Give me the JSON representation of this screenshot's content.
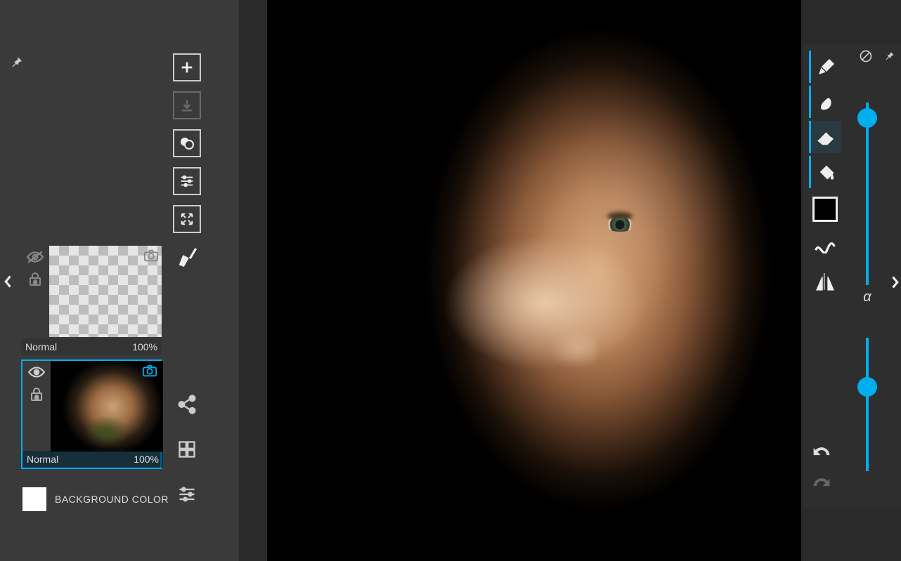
{
  "left_panel": {
    "pin": "pin-icon",
    "actions": [
      {
        "name": "add-layer-button",
        "icon": "plus-icon"
      },
      {
        "name": "merge-down-button",
        "icon": "arrow-down-box-icon",
        "disabled": true
      },
      {
        "name": "duplicate-layer-button",
        "icon": "overlap-circles-icon"
      },
      {
        "name": "layer-options-button",
        "icon": "sliders-icon"
      },
      {
        "name": "transform-layer-button",
        "icon": "expand-arrows-icon"
      },
      {
        "name": "clear-layer-button",
        "icon": "brush-sweep-icon",
        "noborder": true
      }
    ],
    "layers": [
      {
        "blend": "Normal",
        "opacity": "100%",
        "visible": false,
        "locked": true,
        "selected": false,
        "thumb": "transparent"
      },
      {
        "blend": "Normal",
        "opacity": "100%",
        "visible": true,
        "locked": true,
        "selected": true,
        "thumb": "portrait"
      }
    ],
    "bottom_actions": [
      {
        "name": "share-button",
        "icon": "share-icon"
      },
      {
        "name": "grid-menu-button",
        "icon": "grid-icon"
      },
      {
        "name": "settings-button",
        "icon": "sliders-icon"
      }
    ],
    "background": {
      "color": "#ffffff",
      "label": "BACKGROUND COLOR"
    }
  },
  "tools_panel": {
    "top_icons": [
      {
        "name": "disable-button",
        "icon": "no-symbol-icon"
      },
      {
        "name": "pin-tools-button",
        "icon": "pin-icon"
      }
    ],
    "tools": [
      {
        "name": "pen-tool",
        "icon": "pen-nib-icon",
        "group_active": true
      },
      {
        "name": "smudge-tool",
        "icon": "smudge-icon",
        "group_active": true
      },
      {
        "name": "eraser-tool",
        "icon": "eraser-icon",
        "group_active": true,
        "selected": true
      },
      {
        "name": "fill-tool",
        "icon": "paint-bucket-icon",
        "group_active": true
      }
    ],
    "color": "#000000",
    "modifiers": [
      {
        "name": "stroke-tool",
        "icon": "wave-icon"
      },
      {
        "name": "symmetry-tool",
        "icon": "mirror-icon"
      }
    ],
    "slider1": {
      "value": 8,
      "max": 100
    },
    "alpha_label": "α",
    "slider2": {
      "value": 30,
      "max": 100
    },
    "undo": {
      "name": "undo-button",
      "icon": "undo-icon"
    },
    "redo": {
      "name": "redo-button",
      "icon": "redo-icon",
      "disabled": true
    }
  },
  "canvas": {
    "description": "digital painting portrait"
  }
}
